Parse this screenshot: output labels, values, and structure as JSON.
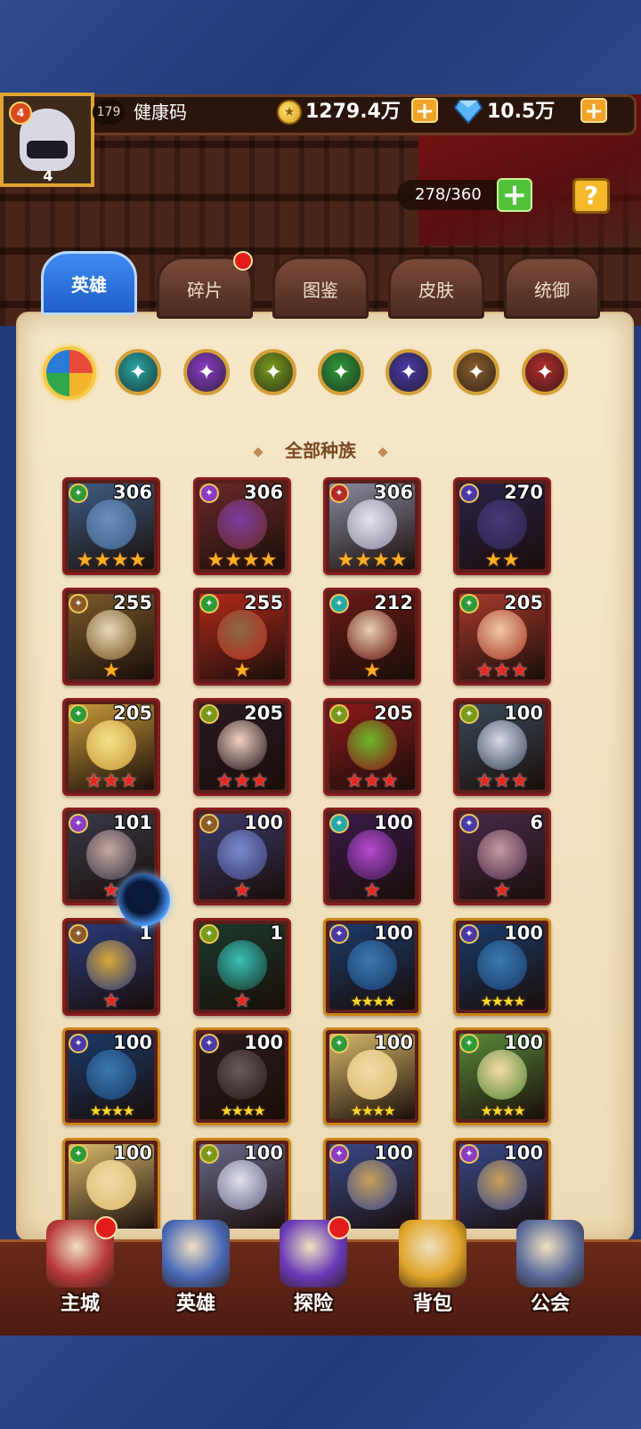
{
  "player": {
    "level": "179",
    "name": "健康码",
    "avatar_badge": "4",
    "avatar_rank": "4"
  },
  "resources": {
    "gold": "1279.4万",
    "gems": "10.5万"
  },
  "hero_capacity": "278/360",
  "help_label": "?",
  "tabs": [
    {
      "label": "英雄",
      "active": true
    },
    {
      "label": "碎片",
      "has_notification": true
    },
    {
      "label": "图鉴"
    },
    {
      "label": "皮肤"
    },
    {
      "label": "统御"
    }
  ],
  "race_filters": [
    {
      "name": "all-races",
      "color": "#e84a3a",
      "selected": true
    },
    {
      "name": "race-2",
      "color": "#26a8a6"
    },
    {
      "name": "race-3",
      "color": "#8a3cc4"
    },
    {
      "name": "race-4",
      "color": "#7a9a1c"
    },
    {
      "name": "race-5",
      "color": "#2e9a3a"
    },
    {
      "name": "race-6",
      "color": "#4a3aa8"
    },
    {
      "name": "race-7",
      "color": "#8a5a2a"
    },
    {
      "name": "race-8",
      "color": "#b42a2a"
    }
  ],
  "section_title": "全部种族",
  "heroes": [
    {
      "level": "306",
      "stars": "★★★★",
      "star_color": "orange",
      "race_color": "#2e9a3a",
      "art": "#3e5e84",
      "skin": "#6a8fc0",
      "frame": "red"
    },
    {
      "level": "306",
      "stars": "★★★★",
      "star_color": "orange",
      "race_color": "#8a3cc4",
      "art": "#6a2a2a",
      "skin": "#7a3ca0",
      "frame": "red"
    },
    {
      "level": "306",
      "stars": "★★★★",
      "star_color": "orange",
      "race_color": "#b42a2a",
      "art": "#8a8aa0",
      "skin": "#e4e4ee",
      "frame": "red"
    },
    {
      "level": "270",
      "stars": "★★",
      "star_color": "orange",
      "race_color": "#4a3aa8",
      "art": "#2a2248",
      "skin": "#4a3a7a",
      "frame": "red"
    },
    {
      "level": "255",
      "stars": "★",
      "star_color": "orange",
      "race_color": "#8a5a2a",
      "art": "#7a5a2a",
      "skin": "#e8d8b8",
      "frame": "red"
    },
    {
      "level": "255",
      "stars": "★",
      "star_color": "orange",
      "race_color": "#2e9a3a",
      "art": "#b42a1a",
      "skin": "#8a6a4a",
      "frame": "red"
    },
    {
      "level": "212",
      "stars": "★",
      "star_color": "orange",
      "race_color": "#26a8a6",
      "art": "#6a1a14",
      "skin": "#e8d0b0",
      "frame": "red"
    },
    {
      "level": "205",
      "stars": "★★★",
      "star_color": "red",
      "race_color": "#2e9a3a",
      "art": "#a83a2a",
      "skin": "#f0c8a8",
      "frame": "red"
    },
    {
      "level": "205",
      "stars": "★★★",
      "star_color": "red",
      "race_color": "#2e9a3a",
      "art": "#c89a3a",
      "skin": "#f5e28a",
      "frame": "red"
    },
    {
      "level": "205",
      "stars": "★★★",
      "star_color": "red",
      "race_color": "#7a9a1c",
      "art": "#2a1a24",
      "skin": "#f0d0c0",
      "frame": "red"
    },
    {
      "level": "205",
      "stars": "★★★",
      "star_color": "red",
      "race_color": "#7a9a1c",
      "art": "#8a1a1a",
      "skin": "#6ab82a",
      "frame": "red"
    },
    {
      "level": "100",
      "stars": "★★★",
      "star_color": "red",
      "race_color": "#7a9a1c",
      "art": "#3a4a5a",
      "skin": "#d8d8e8",
      "frame": "red"
    },
    {
      "level": "101",
      "stars": "★",
      "star_color": "red",
      "race_color": "#8a3cc4",
      "art": "#3a3a4a",
      "skin": "#c8a8a0",
      "frame": "red"
    },
    {
      "level": "100",
      "stars": "★",
      "star_color": "red",
      "race_color": "#8a5a2a",
      "art": "#3a3a6a",
      "skin": "#7a8ad0",
      "frame": "red"
    },
    {
      "level": "100",
      "stars": "★",
      "star_color": "red",
      "race_color": "#26a8a6",
      "art": "#3a1a4a",
      "skin": "#b84ad0",
      "frame": "red"
    },
    {
      "level": "6",
      "stars": "★",
      "star_color": "red",
      "race_color": "#4a3aa8",
      "art": "#4a2a4a",
      "skin": "#c89aa0",
      "frame": "red"
    },
    {
      "level": "1",
      "stars": "★",
      "star_color": "red",
      "race_color": "#8a5a2a",
      "art": "#2a3a7a",
      "skin": "#d8a83a",
      "frame": "red"
    },
    {
      "level": "1",
      "stars": "★",
      "star_color": "red",
      "race_color": "#7a9a1c",
      "art": "#1a3a2a",
      "skin": "#3ac0b8",
      "frame": "red"
    },
    {
      "level": "100",
      "stars": "★★★★",
      "star_color": "yellow",
      "race_color": "#4a3aa8",
      "art": "#1a3a6a",
      "skin": "#3a7ab0",
      "frame": "gold"
    },
    {
      "level": "100",
      "stars": "★★★★",
      "star_color": "yellow",
      "race_color": "#4a3aa8",
      "art": "#1a3a6a",
      "skin": "#3a7ab0",
      "frame": "gold"
    },
    {
      "level": "100",
      "stars": "★★★★",
      "star_color": "yellow",
      "race_color": "#4a3aa8",
      "art": "#1a3a6a",
      "skin": "#3a7ab0",
      "frame": "gold"
    },
    {
      "level": "100",
      "stars": "★★★★",
      "star_color": "yellow",
      "race_color": "#4a3aa8",
      "art": "#2a1a1a",
      "skin": "#6a5a5a",
      "frame": "gold"
    },
    {
      "level": "100",
      "stars": "★★★★",
      "star_color": "yellow",
      "race_color": "#2e9a3a",
      "art": "#d8b86a",
      "skin": "#f5dca8",
      "frame": "gold"
    },
    {
      "level": "100",
      "stars": "★★★★",
      "star_color": "yellow",
      "race_color": "#2e9a3a",
      "art": "#5a8a3a",
      "skin": "#f5dca8",
      "frame": "gold"
    },
    {
      "level": "100",
      "stars": "",
      "star_color": "yellow",
      "race_color": "#2e9a3a",
      "art": "#d8b86a",
      "skin": "#f5dca8",
      "frame": "gold"
    },
    {
      "level": "100",
      "stars": "",
      "star_color": "yellow",
      "race_color": "#7a9a1c",
      "art": "#6a6a8a",
      "skin": "#e0e0ee",
      "frame": "gold"
    },
    {
      "level": "100",
      "stars": "",
      "star_color": "yellow",
      "race_color": "#8a3cc4",
      "art": "#3a4a8a",
      "skin": "#c8a05a",
      "frame": "gold"
    },
    {
      "level": "100",
      "stars": "",
      "star_color": "yellow",
      "race_color": "#8a3cc4",
      "art": "#3a4a8a",
      "skin": "#c8a05a",
      "frame": "gold"
    }
  ],
  "bottom_nav": [
    {
      "label": "主城",
      "icon": "castle-icon",
      "color": "#b83a3a",
      "has_notification": true
    },
    {
      "label": "英雄",
      "icon": "hero-portrait-icon",
      "color": "#4a6ab8"
    },
    {
      "label": "探险",
      "icon": "portal-icon",
      "color": "#6a3ab8",
      "has_notification": true
    },
    {
      "label": "背包",
      "icon": "backpack-icon",
      "color": "#e0a52a"
    },
    {
      "label": "公会",
      "icon": "guild-tower-icon",
      "color": "#5a6a9a"
    }
  ]
}
